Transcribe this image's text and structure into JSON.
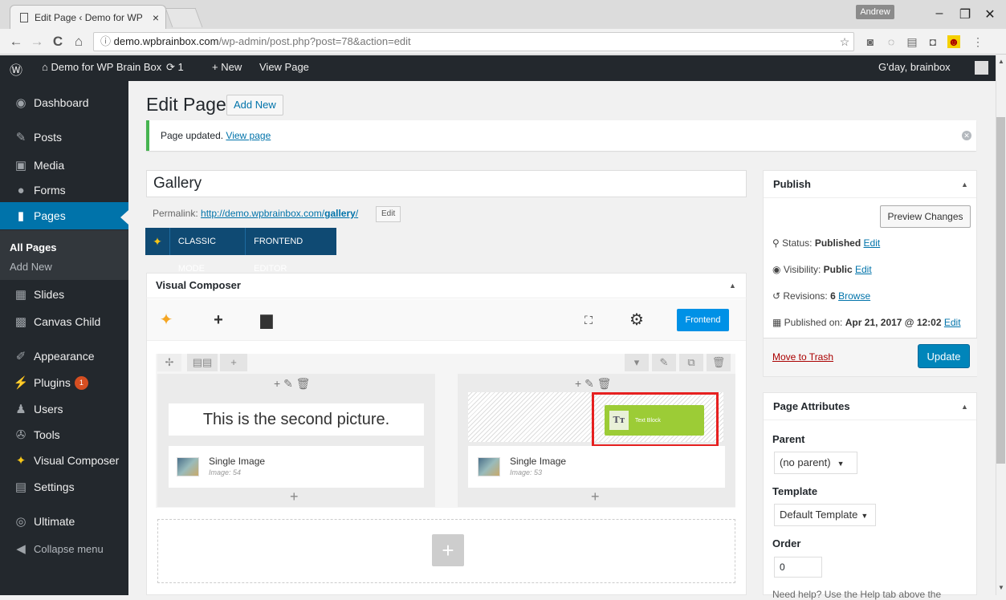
{
  "browser": {
    "tab_title": "Edit Page ‹ Demo for WP",
    "tab_close": "×",
    "profile": "Andrew",
    "window_minimize": "–",
    "window_restore": "❐",
    "window_close": "✕",
    "back": "←",
    "forward": "→",
    "reload": "C",
    "home": "⌂",
    "url_info": "ⓘ",
    "url_domain": "demo.wpbrainbox.com",
    "url_path": "/wp-admin/post.php?post=78&action=edit"
  },
  "adminbar": {
    "wp_logo": "Ⓦ",
    "site_name": "Demo for WP Brain Box",
    "updates_count": "1",
    "new_label": "New",
    "view_page": "View Page",
    "greeting": "G'day, brainbox"
  },
  "sidebar": {
    "items": [
      {
        "label": "Dashboard",
        "icon": "dashboard-icon"
      },
      {
        "label": "Posts",
        "icon": "pin-icon"
      },
      {
        "label": "Media",
        "icon": "media-icon"
      },
      {
        "label": "Forms",
        "icon": "forms-icon"
      },
      {
        "label": "Pages",
        "icon": "pages-icon"
      },
      {
        "label": "Slides",
        "icon": "slides-icon"
      },
      {
        "label": "Canvas Child",
        "icon": "canvas-icon"
      },
      {
        "label": "Appearance",
        "icon": "brush-icon"
      },
      {
        "label": "Plugins",
        "icon": "plugin-icon",
        "badge": "1"
      },
      {
        "label": "Users",
        "icon": "users-icon"
      },
      {
        "label": "Tools",
        "icon": "wrench-icon"
      },
      {
        "label": "Visual Composer",
        "icon": "vc-icon"
      },
      {
        "label": "Settings",
        "icon": "settings-icon"
      },
      {
        "label": "Ultimate",
        "icon": "ultimate-icon"
      },
      {
        "label": "Collapse menu",
        "icon": "collapse-icon"
      }
    ],
    "submenu": {
      "all_pages": "All Pages",
      "add_new": "Add New"
    }
  },
  "main": {
    "title": "Edit Page",
    "add_new": "Add New",
    "notice_text": "Page updated.",
    "notice_link": "View page",
    "post_title": "Gallery",
    "permalink_label": "Permalink:",
    "permalink_url": "http://demo.wpbrainbox.com/",
    "permalink_slug": "gallery",
    "permalink_end": "/",
    "permalink_edit": "Edit",
    "classic_mode": "CLASSIC MODE",
    "frontend_editor": "FRONTEND EDITOR"
  },
  "vc": {
    "heading": "Visual Composer",
    "frontend": "Frontend",
    "left_text": "This is the second picture.",
    "left_image_title": "Single Image",
    "left_image_sub": "Image: 54",
    "right_image_title": "Single Image",
    "right_image_sub": "Image: 53",
    "dragging_label": "Text Block",
    "tt": "Tт"
  },
  "publish": {
    "heading": "Publish",
    "preview": "Preview Changes",
    "status_label": "Status:",
    "status_value": "Published",
    "visibility_label": "Visibility:",
    "visibility_value": "Public",
    "revisions_label": "Revisions:",
    "revisions_value": "6",
    "revisions_link": "Browse",
    "published_label": "Published on:",
    "published_value": "Apr 21, 2017 @ 12:02",
    "edit": "Edit",
    "trash": "Move to Trash",
    "update": "Update"
  },
  "attributes": {
    "heading": "Page Attributes",
    "parent_label": "Parent",
    "parent_value": "(no parent)",
    "template_label": "Template",
    "template_value": "Default Template",
    "order_label": "Order",
    "order_value": "0",
    "help": "Need help? Use the Help tab above the"
  },
  "colors": {
    "wp_blue": "#0073aa",
    "admin_dark": "#23282d",
    "vc_green": "#9ccc36",
    "highlight_red": "#e62020"
  }
}
